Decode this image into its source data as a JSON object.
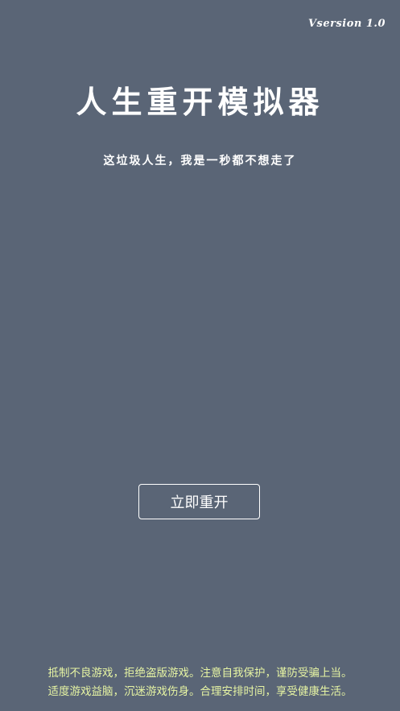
{
  "header": {
    "version": "Vsersion 1.0"
  },
  "main": {
    "title": "人生重开模拟器",
    "subtitle": "这垃圾人生，我是一秒都不想走了",
    "restart_label": "立即重开"
  },
  "footer": {
    "notice_line1": "抵制不良游戏，拒绝盗版游戏。注意自我保护，谨防受骗上当。",
    "notice_line2": "适度游戏益脑，沉迷游戏伤身。合理安排时间，享受健康生活。"
  },
  "colors": {
    "background": "#5a6576",
    "text": "#ffffff",
    "notice": "#e6f4a3"
  }
}
